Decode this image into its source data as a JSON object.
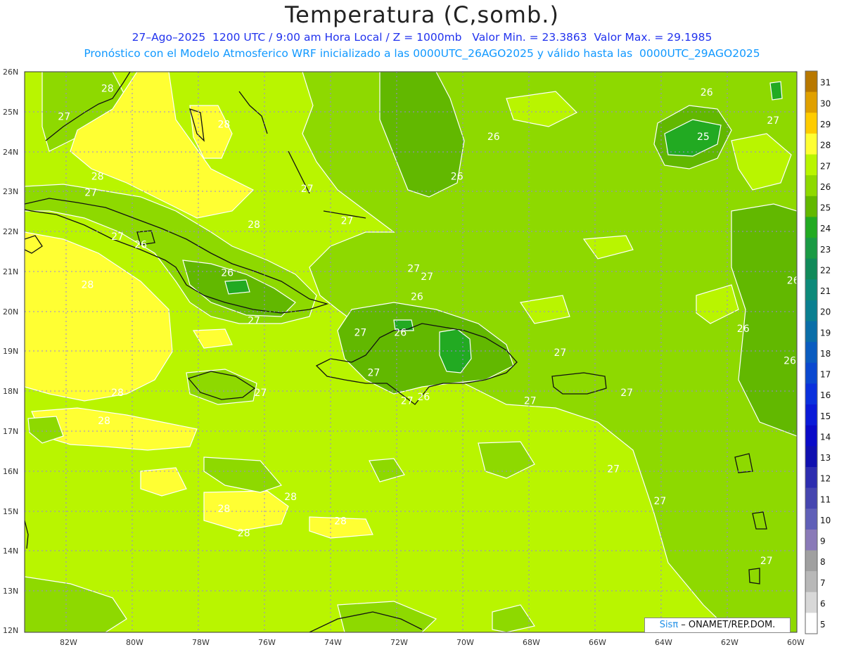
{
  "header": {
    "title": "Temperatura (C,somb.)",
    "line1": "27–Ago–2025  1200 UTC / 9:00 am Hora Local / Z = 1000mb   Valor Min. = 23.3863  Valor Max. = 29.1985",
    "line2": "Pronóstico con el Modelo Atmosferico WRF inicializado a las 0000UTC_26AGO2025 y válido hasta las  0000UTC_29AGO2025"
  },
  "axes": {
    "lat_labels": [
      "26N",
      "25N",
      "24N",
      "23N",
      "22N",
      "21N",
      "20N",
      "19N",
      "18N",
      "17N",
      "16N",
      "15N",
      "14N",
      "13N",
      "12N"
    ],
    "lon_labels": [
      "82W",
      "80W",
      "78W",
      "76W",
      "74W",
      "72W",
      "70W",
      "68W",
      "66W",
      "64W",
      "62W",
      "60W"
    ]
  },
  "colorbar": {
    "levels": [
      "31",
      "30",
      "29",
      "28",
      "27",
      "26",
      "25",
      "24",
      "23",
      "22",
      "21",
      "20",
      "19",
      "18",
      "17",
      "16",
      "15",
      "14",
      "13",
      "12",
      "11",
      "10",
      "9",
      "8",
      "7",
      "6",
      "5"
    ],
    "colors": [
      "#b87800",
      "#e0a000",
      "#ffcc00",
      "#ffff33",
      "#b9f500",
      "#8ed900",
      "#62b800",
      "#22aa22",
      "#1a9a44",
      "#118a5a",
      "#0d8a7a",
      "#0a7f90",
      "#0a6ea8",
      "#0a5cc0",
      "#0a48d0",
      "#0a30dd",
      "#0a1ad8",
      "#0a0ac8",
      "#1010b0",
      "#2d2db0",
      "#4646b0",
      "#6060b8",
      "#8a7ab8",
      "#a0a0a0",
      "#b8b8b8",
      "#d8d8d8",
      "#ffffff"
    ]
  },
  "contour_labels": [
    {
      "text": "28",
      "lon": -80.9,
      "lat": 25.5
    },
    {
      "text": "27",
      "lon": -82.2,
      "lat": 24.8
    },
    {
      "text": "28",
      "lon": -77.4,
      "lat": 24.6
    },
    {
      "text": "28",
      "lon": -81.2,
      "lat": 23.3
    },
    {
      "text": "27",
      "lon": -81.4,
      "lat": 22.9
    },
    {
      "text": "28",
      "lon": -76.5,
      "lat": 22.1
    },
    {
      "text": "27",
      "lon": -80.6,
      "lat": 21.8
    },
    {
      "text": "26",
      "lon": -79.9,
      "lat": 21.6
    },
    {
      "text": "28",
      "lon": -81.5,
      "lat": 20.6
    },
    {
      "text": "26",
      "lon": -77.3,
      "lat": 20.9
    },
    {
      "text": "27",
      "lon": -74.9,
      "lat": 23.0
    },
    {
      "text": "27",
      "lon": -73.7,
      "lat": 22.2
    },
    {
      "text": "27",
      "lon": -71.7,
      "lat": 21.0
    },
    {
      "text": "27",
      "lon": -71.3,
      "lat": 20.8
    },
    {
      "text": "26",
      "lon": -71.6,
      "lat": 20.3
    },
    {
      "text": "27",
      "lon": -76.5,
      "lat": 19.7
    },
    {
      "text": "27",
      "lon": -73.3,
      "lat": 19.4
    },
    {
      "text": "26",
      "lon": -72.1,
      "lat": 19.4
    },
    {
      "text": "27",
      "lon": -72.9,
      "lat": 18.4
    },
    {
      "text": "27",
      "lon": -76.3,
      "lat": 17.9
    },
    {
      "text": "28",
      "lon": -80.6,
      "lat": 17.9
    },
    {
      "text": "28",
      "lon": -81.0,
      "lat": 17.2
    },
    {
      "text": "27",
      "lon": -71.9,
      "lat": 17.7
    },
    {
      "text": "26",
      "lon": -71.4,
      "lat": 17.8
    },
    {
      "text": "27",
      "lon": -68.2,
      "lat": 17.7
    },
    {
      "text": "27",
      "lon": -65.3,
      "lat": 17.9
    },
    {
      "text": "27",
      "lon": -67.3,
      "lat": 18.9
    },
    {
      "text": "26",
      "lon": -69.3,
      "lat": 24.3
    },
    {
      "text": "26",
      "lon": -70.4,
      "lat": 23.3
    },
    {
      "text": "26",
      "lon": -62.9,
      "lat": 25.4
    },
    {
      "text": "25",
      "lon": -63.0,
      "lat": 24.3
    },
    {
      "text": "27",
      "lon": -60.9,
      "lat": 24.7
    },
    {
      "text": "26",
      "lon": -60.3,
      "lat": 20.7
    },
    {
      "text": "26",
      "lon": -61.8,
      "lat": 19.5
    },
    {
      "text": "26",
      "lon": -60.4,
      "lat": 18.7
    },
    {
      "text": "27",
      "lon": -65.7,
      "lat": 16.0
    },
    {
      "text": "27",
      "lon": -64.3,
      "lat": 15.2
    },
    {
      "text": "27",
      "lon": -61.1,
      "lat": 13.7
    },
    {
      "text": "28",
      "lon": -77.4,
      "lat": 15.0
    },
    {
      "text": "28",
      "lon": -75.4,
      "lat": 15.3
    },
    {
      "text": "28",
      "lon": -73.9,
      "lat": 14.7
    },
    {
      "text": "28",
      "lon": -76.8,
      "lat": 14.4
    }
  ],
  "credit": {
    "brand": "Sisπ",
    "text": " – ONAMET/REP.DOM."
  }
}
